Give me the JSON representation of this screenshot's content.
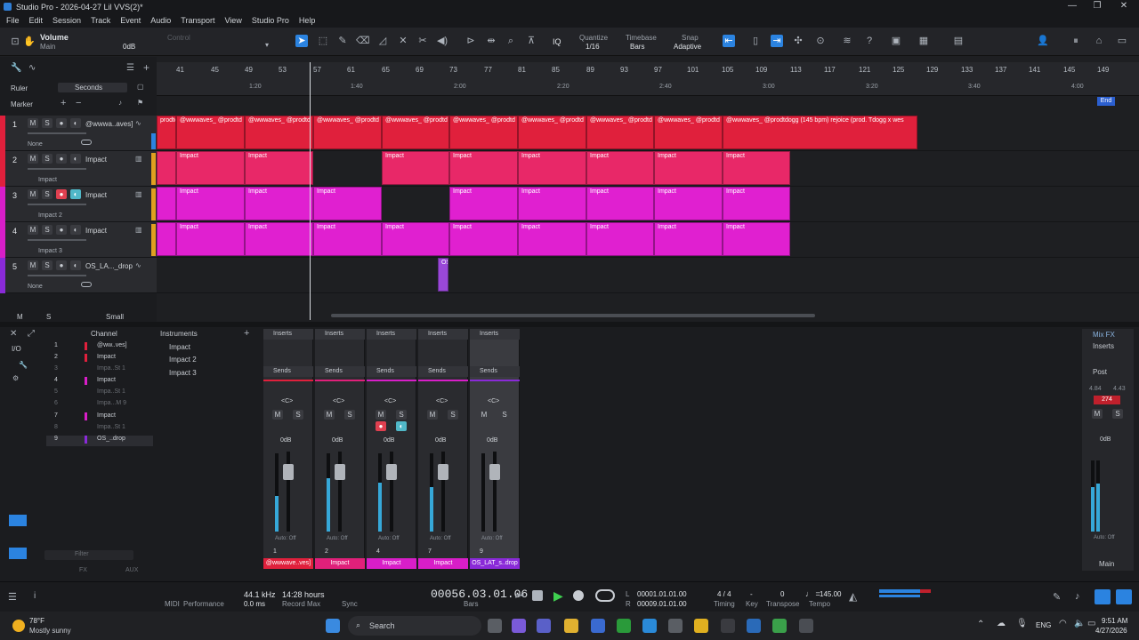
{
  "window": {
    "title": "Studio Pro - 2026-04-27 Lil  VVS(2)*"
  },
  "menu": [
    "File",
    "Edit",
    "Session",
    "Track",
    "Event",
    "Audio",
    "Transport",
    "View",
    "Studio Pro",
    "Help"
  ],
  "toolbar": {
    "param_name": "Volume",
    "param_target": "Main",
    "param_value": "0dB",
    "control_label": "Control",
    "quantize_label": "Quantize",
    "quantize_value": "1/16",
    "timebase_label": "Timebase",
    "timebase_value": "Bars",
    "snap_label": "Snap",
    "snap_value": "Adaptive",
    "iq_label": "IQ"
  },
  "panel": {
    "ruler_label": "Ruler",
    "ruler_value": "Seconds",
    "marker_label": "Marker",
    "footer_m": "M",
    "footer_s": "S",
    "footer_size": "Small"
  },
  "ruler": {
    "bars": [
      "41",
      "45",
      "49",
      "53",
      "57",
      "61",
      "65",
      "69",
      "73",
      "77",
      "81",
      "85",
      "89",
      "93",
      "97",
      "101",
      "105",
      "109",
      "113",
      "117",
      "121",
      "125",
      "129",
      "133",
      "137",
      "141",
      "145",
      "149"
    ],
    "times": [
      "1:20",
      "1:40",
      "2:00",
      "2:20",
      "2:40",
      "3:00",
      "3:20",
      "3:40",
      "4:00"
    ],
    "end_label": "End"
  },
  "tracks": [
    {
      "num": "1",
      "name": "@wwwa..aves]",
      "sub": "None",
      "color": "#e0203c"
    },
    {
      "num": "2",
      "name": "Impact",
      "sub": "Impact",
      "color": "#e0203c"
    },
    {
      "num": "3",
      "name": "Impact",
      "sub": "Impact 2",
      "color": "#d81ec8"
    },
    {
      "num": "4",
      "name": "Impact",
      "sub": "Impact 3",
      "color": "#d81ec8"
    },
    {
      "num": "5",
      "name": "OS_LA..._drop",
      "sub": "None",
      "color": "#8a2ad8"
    }
  ],
  "clips": {
    "track1_label": "@wwwaves_ @prodtd",
    "track1_long_label": "@wwwaves_ @prodtdogg (145 bpm) rejoice (prod. Tdogg x wes",
    "first_label": "prodtd",
    "impact_label": "Impact",
    "drop_label": "OS"
  },
  "channels": {
    "header": "Channel",
    "io_label": "I/O",
    "rows": [
      {
        "num": "1",
        "name": "@ww..ves]",
        "color": "#e0203c",
        "dim": false
      },
      {
        "num": "2",
        "name": "Impact",
        "color": "#e0203c",
        "dim": false
      },
      {
        "num": "3",
        "name": "Impa..St 1",
        "color": "#e0203c",
        "dim": true
      },
      {
        "num": "4",
        "name": "Impact",
        "color": "#d81ec8",
        "dim": false
      },
      {
        "num": "5",
        "name": "Impa..St 1",
        "color": "#d81ec8",
        "dim": true
      },
      {
        "num": "6",
        "name": "Impa...M 9",
        "color": "#d81ec8",
        "dim": true
      },
      {
        "num": "7",
        "name": "Impact",
        "color": "#d81ec8",
        "dim": false
      },
      {
        "num": "8",
        "name": "Impa..St 1",
        "color": "#d81ec8",
        "dim": true
      },
      {
        "num": "9",
        "name": "OS_..drop",
        "color": "#8a2ad8",
        "dim": false
      }
    ],
    "filter_placeholder": "Filter",
    "footer_aux": "AUX",
    "footer_fx": "FX"
  },
  "instruments": {
    "header": "Instruments",
    "items": [
      "Impact",
      "Impact 2",
      "Impact 3"
    ]
  },
  "mixer": {
    "inserts_label": "Inserts",
    "sends_label": "Sends",
    "pan_value": "<C>",
    "gain_value": "0dB",
    "auto_label": "Auto: Off",
    "scale": [
      "10",
      "6",
      "0",
      "-6",
      "-12",
      "-18",
      "-24",
      "-36",
      "-48",
      "-72"
    ],
    "strips": [
      {
        "num": "1",
        "label": "@wwwave..ves]",
        "color": "#e0203c"
      },
      {
        "num": "2",
        "label": "Impact",
        "color": "#e0207a"
      },
      {
        "num": "4",
        "label": "Impact",
        "color": "#d81ec8"
      },
      {
        "num": "7",
        "label": "Impact",
        "color": "#d81ec8"
      },
      {
        "num": "9",
        "label": "OS_LAT_s..drop",
        "color": "#8a2ad8"
      }
    ]
  },
  "main_bus": {
    "mixfx_label": "Mix FX",
    "inserts_label": "Inserts",
    "post_label": "Post",
    "peak_left": "4.84",
    "peak_right": "4.43",
    "peak_red": "274",
    "gain_value": "0dB",
    "auto_label": "Auto: Off",
    "name": "Main"
  },
  "transport": {
    "midi_label": "MIDI",
    "performance_label": "Performance",
    "sample_rate": "44.1 kHz",
    "latency": "0.0 ms",
    "record_time": "14:28 hours",
    "record_max_label": "Record Max",
    "sync_label": "Sync",
    "position": "00056.03.01.06",
    "position_unit": "Bars",
    "loop_l_label": "L",
    "loop_l": "00001.01.01.00",
    "loop_r_label": "R",
    "loop_r": "00009.01.01.00",
    "timing_value": "4 / 4",
    "timing_label": "Timing",
    "key_value": "-",
    "key_label": "Key",
    "transpose_value": "0",
    "transpose_label": "Transpose",
    "tempo_value": "145.00",
    "tempo_label": "Tempo"
  },
  "taskbar": {
    "temperature": "78°F",
    "weather": "Mostly sunny",
    "search_label": "Search",
    "lang": "ENG",
    "time": "9:51 AM",
    "date": "4/27/2026"
  }
}
